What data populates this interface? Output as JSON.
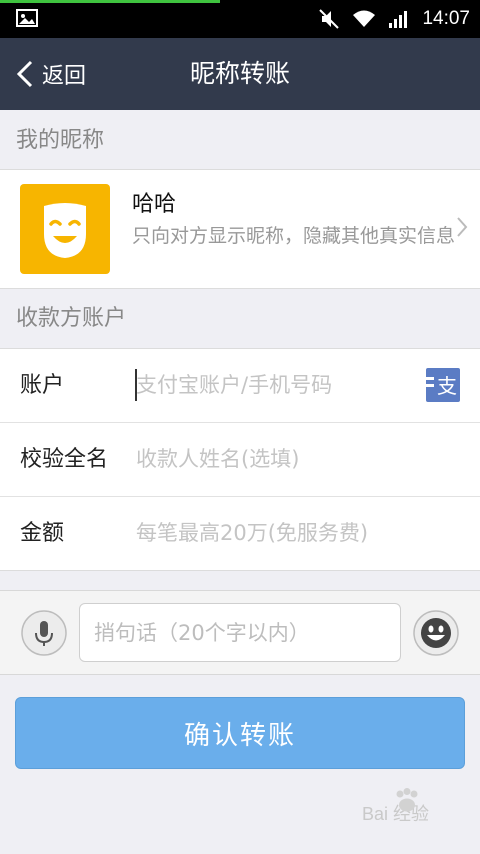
{
  "status_bar": {
    "time": "14:07"
  },
  "title_bar": {
    "back_label": "返回",
    "title": "昵称转账"
  },
  "my_nickname": {
    "header": "我的昵称",
    "nickname": "哈哈",
    "description": "只向对方显示昵称，隐藏其他真实信息"
  },
  "payee": {
    "header": "收款方账户",
    "fields": [
      {
        "label": "账户",
        "placeholder": "支付宝账户/手机号码"
      },
      {
        "label": "校验全名",
        "placeholder": "收款人姓名(选填)"
      },
      {
        "label": "金额",
        "placeholder": "每笔最高20万(免服务费)"
      }
    ]
  },
  "message": {
    "placeholder": "捎句话（20个字以内）"
  },
  "confirm_button": {
    "label": "确认转账"
  },
  "watermark": {
    "text": "Bai 经验"
  },
  "colors": {
    "title_bar": "#323a4c",
    "avatar": "#f7b500",
    "button": "#6aaeeb",
    "contact_icon": "#5b7cc4"
  }
}
